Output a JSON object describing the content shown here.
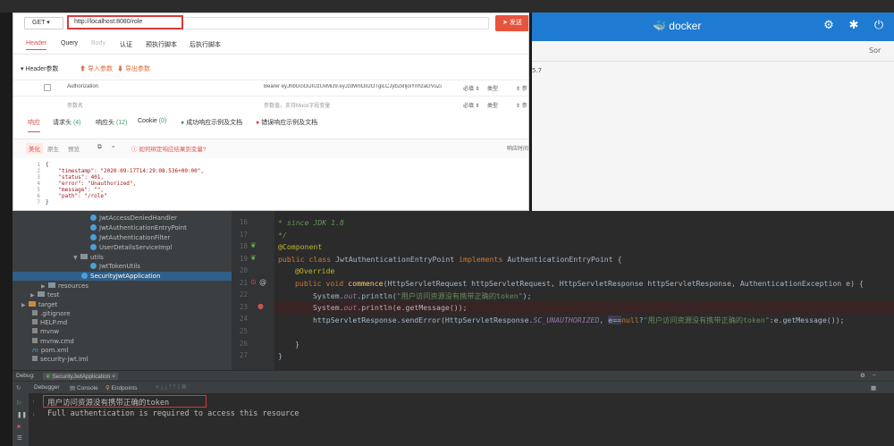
{
  "postman": {
    "method": "GET",
    "url": "http://localhost:8080/role",
    "send_label": "发送",
    "tabs": [
      "Header",
      "Query",
      "Body",
      "认证",
      "预执行脚本",
      "后执行脚本"
    ],
    "header_section_label": "Header参数",
    "import_label": "导入参数",
    "export_label": "导出参数",
    "header_rows": [
      {
        "name": "Authorization",
        "value": "Bearer eyJhbGciOiJIUzUxMiJ9.eyJzdWIiOiI2OTgiLCJyb2xlIjoiYnhzaGVuZi",
        "required": "必填",
        "type": "类型",
        "desc": "参"
      },
      {
        "name": "参数名",
        "value": "参数值，支持Mock字段变量",
        "required": "必填",
        "type": "类型",
        "desc": "参"
      }
    ],
    "resp_tabs": {
      "response": "响应",
      "req_headers": "请求头",
      "req_headers_count": "(4)",
      "resp_headers": "响应头",
      "resp_headers_count": "(12)",
      "cookie": "Cookie",
      "cookie_count": "(0)",
      "success_example": "成功响应示例及文档",
      "error_example": "错误响应示例及文档"
    },
    "format_tabs": [
      "美化",
      "原生",
      "预览"
    ],
    "howto_label": "如何绑定响应结果到变量?",
    "resp_time_label": "响应时间",
    "code_lines": [
      {
        "n": "1",
        "t": "{"
      },
      {
        "n": "2",
        "t": "    \"timestamp\": \"2020-09-17T14:29:08.536+00:00\","
      },
      {
        "n": "3",
        "t": "    \"status\": 401,"
      },
      {
        "n": "4",
        "t": "    \"error\": \"Unauthorized\","
      },
      {
        "n": "5",
        "t": "    \"message\": \"\","
      },
      {
        "n": "6",
        "t": "    \"path\": \"/role\""
      },
      {
        "n": "7",
        "t": "}"
      }
    ]
  },
  "docker": {
    "logo": "docker",
    "sort_label": "Sor",
    "version_frag": "5.7"
  },
  "project_tree": [
    {
      "label": "JwtAccessDeniedHandler",
      "kind": "class"
    },
    {
      "label": "JwtAuthenticationEntryPoint",
      "kind": "class"
    },
    {
      "label": "JwtAuthenticationFilter",
      "kind": "class"
    },
    {
      "label": "UserDetailsServiceImpl",
      "kind": "class"
    },
    {
      "label": "utils",
      "kind": "folder"
    },
    {
      "label": "JwtTokenUtils",
      "kind": "class"
    },
    {
      "label": "SecurityJwtApplication",
      "kind": "class"
    },
    {
      "label": "resources",
      "kind": "folder"
    },
    {
      "label": "test",
      "kind": "folder"
    },
    {
      "label": "target",
      "kind": "folder"
    },
    {
      "label": ".gitignore",
      "kind": "file"
    },
    {
      "label": "HELP.md",
      "kind": "file"
    },
    {
      "label": "mvnw",
      "kind": "file"
    },
    {
      "label": "mvnw.cmd",
      "kind": "file"
    },
    {
      "label": "pom.xml",
      "kind": "file"
    },
    {
      "label": "security-jwt.iml",
      "kind": "file"
    }
  ],
  "editor": {
    "line_numbers": [
      "16",
      "17",
      "18",
      "19",
      "20",
      "21",
      "22",
      "23",
      "24",
      "25",
      "26",
      "27"
    ],
    "l16": "* since JDK 1.8",
    "l17": "*/",
    "l18": "@Component",
    "l19_kw": "public class ",
    "l19_name": "JwtAuthenticationEntryPoint ",
    "l19_kw2": "implements ",
    "l19_rest": "AuthenticationEntryPoint {",
    "l20": "@Override",
    "l21_kw": "public void ",
    "l21_fn": "commence",
    "l21_rest": "(HttpServletRequest httpServletRequest, HttpServletResponse httpServletResponse, AuthenticationException e) {",
    "l22_a": "System.",
    "l22_b": "out",
    "l22_c": ".println(",
    "l22_s": "\"用户访问资源没有携带正确的token\"",
    "l22_d": ");",
    "l23_a": "System.",
    "l23_b": "out",
    "l23_c": ".println(e.getMessage());",
    "l24_a": "httpServletResponse.sendError(HttpServletResponse.",
    "l24_b": "SC_UNAUTHORIZED",
    "l24_c": ", ",
    "l24_d": "e==",
    "l24_e": "null",
    "l24_f": "?",
    "l24_s": "\"用户访问资源没有携带正确的token\"",
    "l24_g": ":e.getMessage());",
    "l26": "}",
    "l27": "}"
  },
  "debug": {
    "label": "Debug:",
    "config": "SecurityJwtApplication",
    "tabs": [
      "Debugger",
      "Console",
      "Endpoints"
    ],
    "console_lines": [
      "用户访问资源没有携带正确的token",
      "Full authentication is required to access this resource"
    ]
  }
}
